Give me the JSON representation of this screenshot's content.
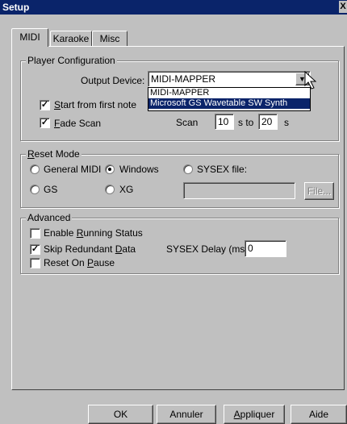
{
  "window": {
    "title": "Setup",
    "close_label": "X"
  },
  "tabs": [
    {
      "label": "MIDI"
    },
    {
      "label": "Karaoke"
    },
    {
      "label": "Misc"
    }
  ],
  "player_config": {
    "legend": "Player Configuration",
    "output_device_label": "Output Device:",
    "output_device_value": "MIDI-MAPPER",
    "dropdown_options": [
      "MIDI-MAPPER",
      "Microsoft GS Wavetable SW Synth"
    ],
    "start_first_note": {
      "prefix": "",
      "underline": "S",
      "rest": "tart from first note",
      "checked": true
    },
    "fade_scan": {
      "underline": "F",
      "rest": "ade Scan",
      "checked": true
    },
    "scan_label": "Scan",
    "scan_from": "10",
    "scan_mid": "s to",
    "scan_to": "20",
    "scan_unit": "s"
  },
  "reset_mode": {
    "legend_underline": "R",
    "legend_rest": "eset Mode",
    "general_midi": "General MIDI",
    "windows": "Windows",
    "sysex_file": "SYSEX file:",
    "gs": "GS",
    "xg": "XG",
    "selected": "windows",
    "file_button": "File..."
  },
  "advanced": {
    "legend": "Advanced",
    "running_status": {
      "prefix": "Enable ",
      "underline": "R",
      "rest": "unning Status",
      "checked": false
    },
    "skip_redundant": {
      "prefix": "Skip Redundant ",
      "underline": "D",
      "rest": "ata",
      "checked": true
    },
    "reset_pause": {
      "prefix": "Reset On ",
      "underline": "P",
      "rest": "ause",
      "checked": false
    },
    "sysex_delay_label": "SYSEX Delay (ms):",
    "sysex_delay_value": "0"
  },
  "buttons": {
    "ok": "OK",
    "cancel": "Annuler",
    "apply_underline": "A",
    "apply_rest": "ppliquer",
    "help": "Aide"
  }
}
